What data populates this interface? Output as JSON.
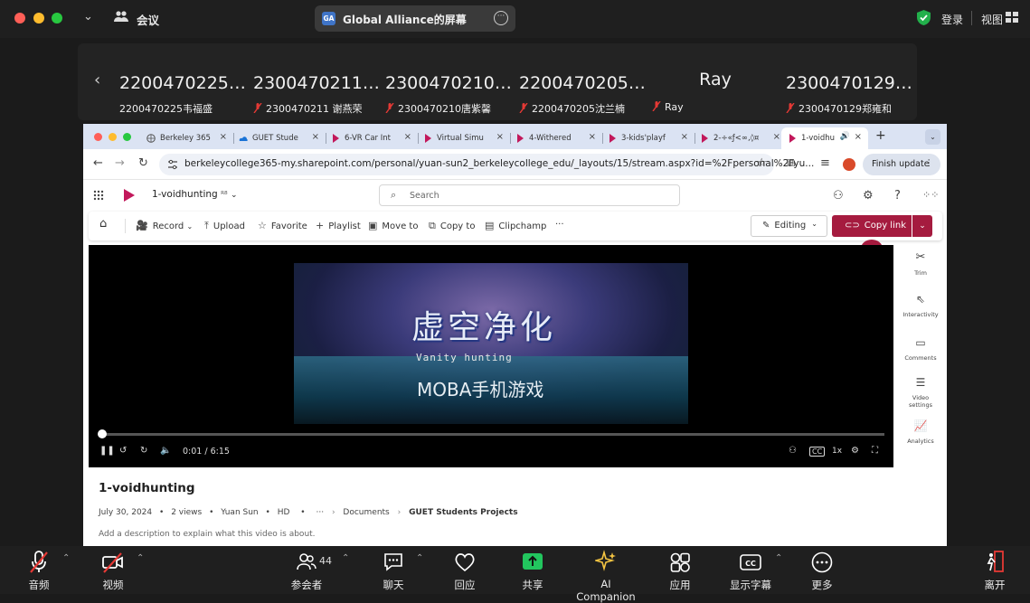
{
  "zoom": {
    "meeting_label": "会议",
    "share_title": "Global Alliance的屏幕",
    "share_badge": "GA",
    "login": "登录",
    "view": "视图",
    "participants_count": "44",
    "bottom": {
      "audio": "音频",
      "video": "视频",
      "participants": "参会者",
      "chat": "聊天",
      "react": "回应",
      "share": "共享",
      "ai": "AI Companion",
      "apps": "应用",
      "captions": "显示字幕",
      "more": "更多",
      "leave": "离开"
    }
  },
  "gallery": [
    {
      "big": "2200470225韦福盛",
      "small": "2200470225韦福盛",
      "muted": false
    },
    {
      "big": "2300470211 谢燕荣",
      "small": "2300470211 谢燕荣",
      "muted": true
    },
    {
      "big": "2300470210唐紫馨",
      "small": "2300470210唐紫馨",
      "muted": true
    },
    {
      "big": "2200470205沈兰楠",
      "small": "2200470205沈兰楠",
      "muted": true
    },
    {
      "big": "Ray",
      "small": "Ray",
      "muted": true
    },
    {
      "big": "2300470129郑雍和",
      "small": "2300470129郑雍和",
      "muted": true
    }
  ],
  "browser": {
    "tabs": [
      {
        "label": "Berkeley 365",
        "active": false
      },
      {
        "label": "GUET Stude",
        "active": false
      },
      {
        "label": "6-VR Car Int",
        "active": false
      },
      {
        "label": "Virtual Simu",
        "active": false
      },
      {
        "label": "4-Withered",
        "active": false
      },
      {
        "label": "3-kids'playf",
        "active": false
      },
      {
        "label": "2-÷«ƒ<∞,◊¤",
        "active": false
      },
      {
        "label": "1-voidhu",
        "active": true
      }
    ],
    "url": "berkeleycollege365-my.sharepoint.com/personal/yuan-sun2_berkeleycollege_edu/_layouts/15/stream.aspx?id=%2Fpersonal%2Fyu...",
    "finish_update": "Finish update"
  },
  "sharepoint": {
    "file_title": "1-voidhunting",
    "search_placeholder": "Search",
    "commands": [
      "Record",
      "Upload",
      "Favorite",
      "Playlist",
      "Move to",
      "Copy to",
      "Clipchamp"
    ],
    "editing": "Editing",
    "copy_link": "Copy link",
    "rail": [
      "Trim",
      "Interactivity",
      "Comments",
      "Video settings",
      "Analytics"
    ]
  },
  "player": {
    "cn_title": "虚空净化",
    "en_sub": "Vanity hunting",
    "subtitle": "MOBA手机游戏",
    "time": "0:01 / 6:15",
    "speed": "1x",
    "progress_fraction": 0.003
  },
  "details": {
    "title": "1-voidhunting",
    "date": "July 30, 2024",
    "views": "2 views",
    "author": "Yuan Sun",
    "quality": "HD",
    "crumb1": "Documents",
    "crumb2": "GUET Students Projects",
    "description_placeholder": "Add a description to explain what this video is about."
  }
}
